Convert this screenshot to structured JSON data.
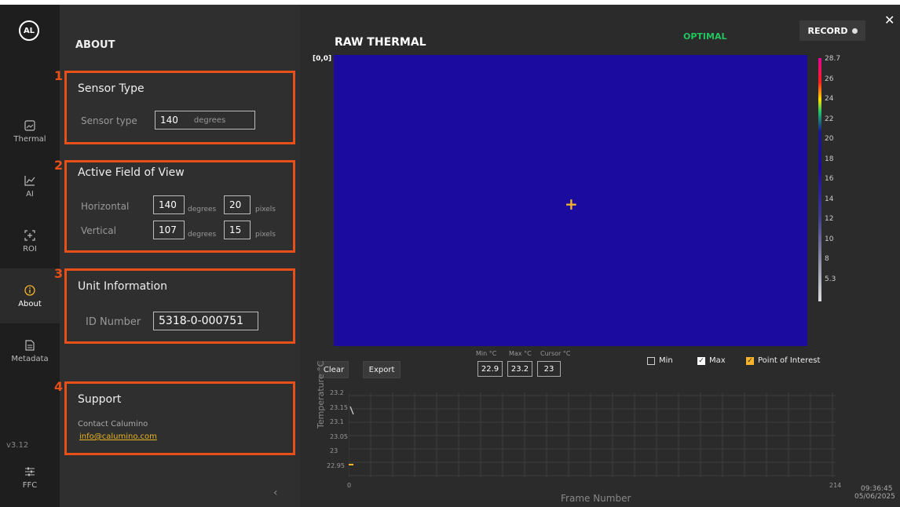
{
  "rail": {
    "logo": "AL",
    "items": [
      {
        "label": "Thermal"
      },
      {
        "label": "AI"
      },
      {
        "label": "ROI"
      },
      {
        "label": "About"
      },
      {
        "label": "Metadata"
      }
    ],
    "version": "v3.12",
    "ffc_label": "FFC",
    "active": "About"
  },
  "about": {
    "title": "ABOUT",
    "sections": [
      {
        "number": "1",
        "title": "Sensor Type",
        "label": "Sensor type",
        "value": "140",
        "unit": "degrees"
      },
      {
        "number": "2",
        "title": "Active Field of View",
        "horizontal": {
          "label": "Horizontal",
          "degrees": "140",
          "deg_unit": "degrees",
          "pixels": "20",
          "px_unit": "pixels"
        },
        "vertical": {
          "label": "Vertical",
          "degrees": "107",
          "deg_unit": "degrees",
          "pixels": "15",
          "px_unit": "pixels"
        }
      },
      {
        "number": "3",
        "title": "Unit Information",
        "label": "ID Number",
        "value": "5318-0-000751"
      },
      {
        "number": "4",
        "title": "Support",
        "contact": "Contact Calumino",
        "email": "info@calumino.com"
      }
    ],
    "collapse_icon": "chevron-left-icon"
  },
  "main": {
    "title": "RAW THERMAL",
    "status": "OPTIMAL",
    "status_color": "#22c55e",
    "record_label": "RECORD",
    "close_glyph": "✕",
    "origin": "[0,0]",
    "thermal_color": "#1c0b9f",
    "poi_color": "#f5b42a",
    "colorbar_ticks": [
      "28.7",
      "26",
      "24",
      "22",
      "20",
      "18",
      "16",
      "14",
      "12",
      "10",
      "8",
      "5.3"
    ]
  },
  "controls": {
    "clear": "Clear",
    "export": "Export",
    "min_label": "Min °C",
    "max_label": "Max °C",
    "cursor_label": "Cursor °C",
    "min_value": "22.9",
    "max_value": "23.2",
    "cursor_value": "23",
    "checkboxes": [
      {
        "label": "Min",
        "checked": false
      },
      {
        "label": "Max",
        "checked": true
      },
      {
        "label": "Point of Interest",
        "checked": true
      }
    ]
  },
  "plot": {
    "y_title": "Temperature °C",
    "y_ticks": [
      "23.2",
      "23.15",
      "23.1",
      "23.05",
      "23",
      "22.95"
    ],
    "x_title": "Frame Number",
    "x_min": "0",
    "x_max": "214"
  },
  "clock": {
    "time": "09:36:45",
    "date": "05/06/2025"
  }
}
